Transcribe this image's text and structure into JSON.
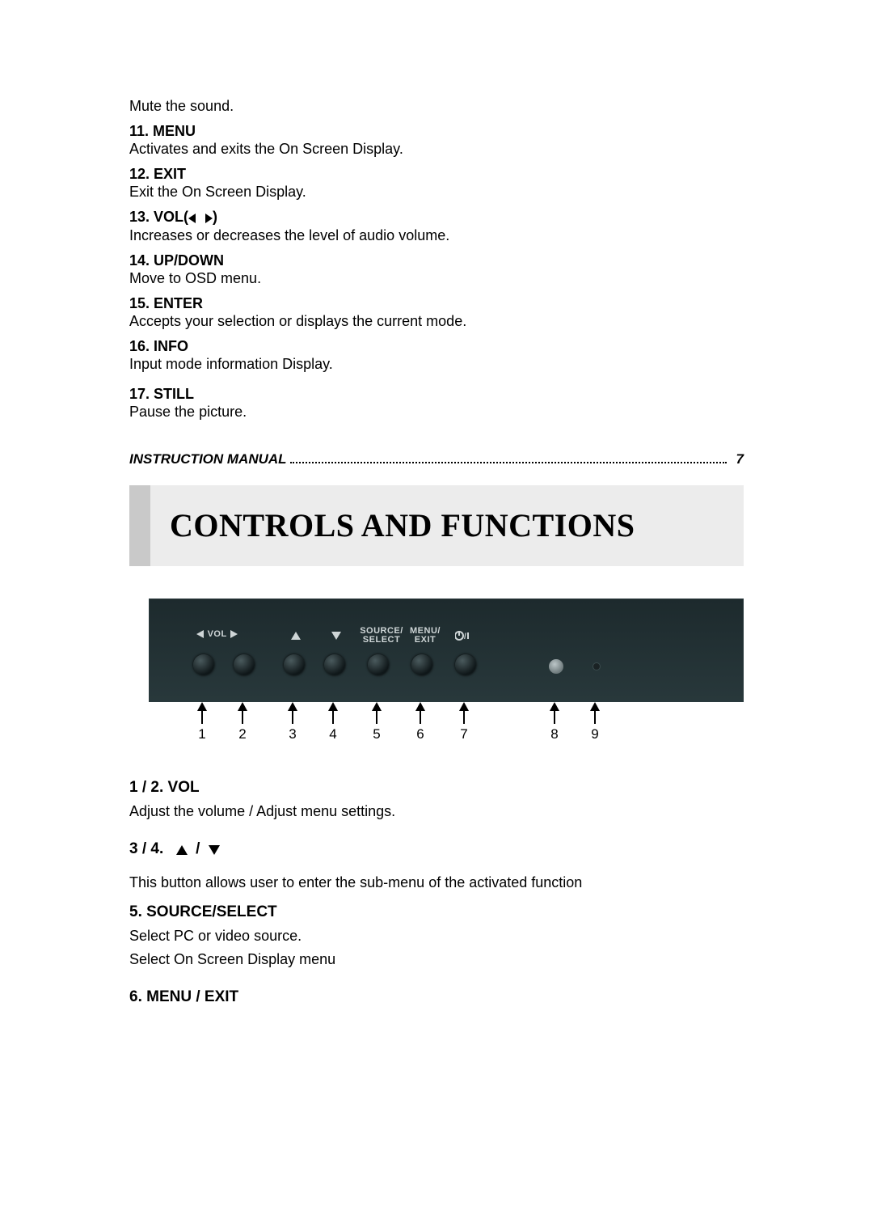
{
  "intro": {
    "mute": "Mute the sound."
  },
  "items": [
    {
      "num": "11.",
      "title": "MENU",
      "desc": "Activates and exits the On Screen Display."
    },
    {
      "num": "12.",
      "title": "EXIT",
      "desc": "Exit the On Screen Display."
    },
    {
      "num": "13.",
      "title": "VOL(",
      "close": ")",
      "desc": "Increases or decreases the level of audio volume."
    },
    {
      "num": "14.",
      "title": "UP/DOWN",
      "desc": "Move to OSD menu."
    },
    {
      "num": "15.",
      "title": "ENTER",
      "desc": "Accepts your selection or displays the current mode."
    },
    {
      "num": "16.",
      "title": "INFO",
      "desc": "Input mode information Display."
    },
    {
      "num": "17.",
      "title": "STILL",
      "desc": "Pause the picture."
    }
  ],
  "footer": {
    "label": "INSTRUCTION MANUAL",
    "page": "7"
  },
  "heading": "CONTROLS AND FUNCTIONS",
  "panel": {
    "labels": {
      "vol": "VOL",
      "source": "SOURCE/",
      "select": "SELECT",
      "menu": "MENU/",
      "exit": "EXIT"
    },
    "callouts": [
      "1",
      "2",
      "3",
      "4",
      "5",
      "6",
      "7",
      "8",
      "9"
    ]
  },
  "below": [
    {
      "h": "1 / 2.   VOL",
      "d": "Adjust the volume / Adjust menu settings."
    },
    {
      "h": "3 / 4.",
      "arrows": true,
      "d": "This button allows user to enter the sub-menu of the activated function"
    },
    {
      "h": "5. SOURCE/SELECT",
      "d": "Select PC or video source.",
      "d2": "Select On Screen Display menu"
    },
    {
      "h": "6. MENU / EXIT"
    }
  ]
}
